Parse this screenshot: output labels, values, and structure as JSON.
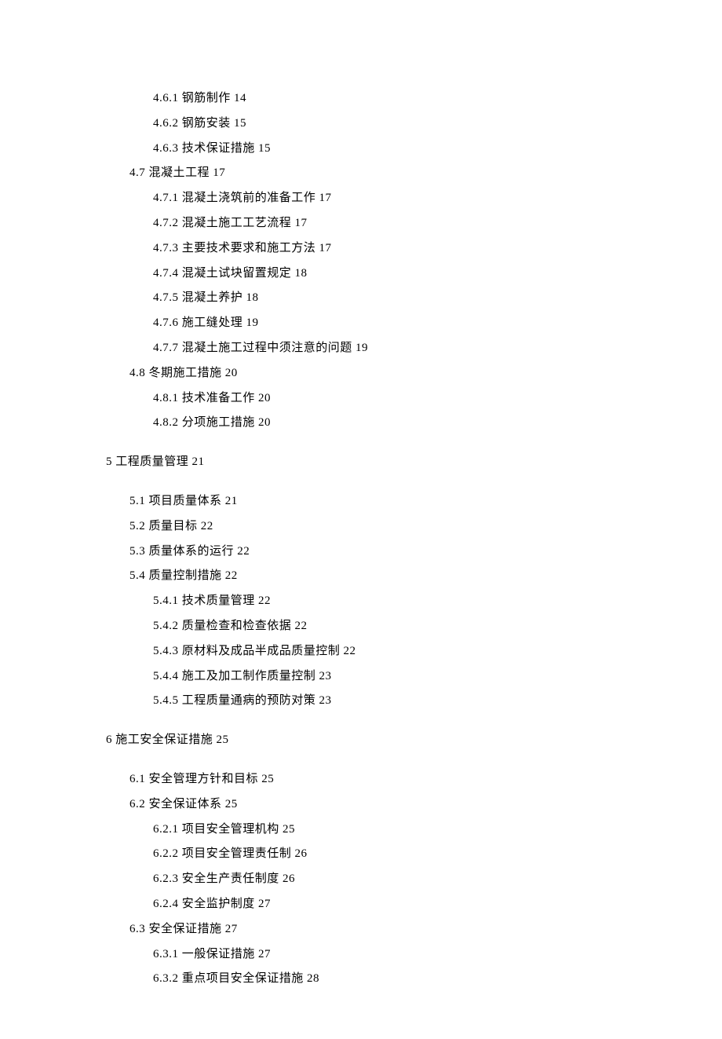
{
  "toc": [
    {
      "level": 3,
      "text": "4.6.1 钢筋制作 14"
    },
    {
      "level": 3,
      "text": "4.6.2 钢筋安装 15"
    },
    {
      "level": 3,
      "text": "4.6.3 技术保证措施 15"
    },
    {
      "level": 2,
      "text": "4.7 混凝土工程 17"
    },
    {
      "level": 3,
      "text": "4.7.1 混凝土浇筑前的准备工作 17"
    },
    {
      "level": 3,
      "text": "4.7.2 混凝土施工工艺流程 17"
    },
    {
      "level": 3,
      "text": "4.7.3 主要技术要求和施工方法 17"
    },
    {
      "level": 3,
      "text": "4.7.4 混凝土试块留置规定 18"
    },
    {
      "level": 3,
      "text": "4.7.5 混凝土养护 18"
    },
    {
      "level": 3,
      "text": "4.7.6 施工缝处理 19"
    },
    {
      "level": 3,
      "text": "4.7.7 混凝土施工过程中须注意的问题 19"
    },
    {
      "level": 2,
      "text": "4.8 冬期施工措施 20"
    },
    {
      "level": 3,
      "text": "4.8.1 技术准备工作 20"
    },
    {
      "level": 3,
      "text": "4.8.2 分项施工措施 20"
    },
    {
      "level": 1,
      "text": "5 工程质量管理 21"
    },
    {
      "level": 2,
      "text": "5.1 项目质量体系 21"
    },
    {
      "level": 2,
      "text": "5.2 质量目标 22"
    },
    {
      "level": 2,
      "text": "5.3 质量体系的运行 22"
    },
    {
      "level": 2,
      "text": "5.4 质量控制措施 22"
    },
    {
      "level": 3,
      "text": "5.4.1 技术质量管理 22"
    },
    {
      "level": 3,
      "text": "5.4.2 质量检查和检查依据 22"
    },
    {
      "level": 3,
      "text": "5.4.3 原材料及成品半成品质量控制 22"
    },
    {
      "level": 3,
      "text": "5.4.4 施工及加工制作质量控制 23"
    },
    {
      "level": 3,
      "text": "5.4.5 工程质量通病的预防对策 23"
    },
    {
      "level": 1,
      "text": "6 施工安全保证措施 25"
    },
    {
      "level": 2,
      "text": "6.1 安全管理方针和目标 25"
    },
    {
      "level": 2,
      "text": "6.2 安全保证体系 25"
    },
    {
      "level": 3,
      "text": "6.2.1 项目安全管理机构 25"
    },
    {
      "level": 3,
      "text": "6.2.2 项目安全管理责任制 26"
    },
    {
      "level": 3,
      "text": "6.2.3 安全生产责任制度 26"
    },
    {
      "level": 3,
      "text": "6.2.4 安全监护制度 27"
    },
    {
      "level": 2,
      "text": "6.3 安全保证措施 27"
    },
    {
      "level": 3,
      "text": "6.3.1 一般保证措施 27"
    },
    {
      "level": 3,
      "text": "6.3.2 重点项目安全保证措施 28"
    }
  ]
}
